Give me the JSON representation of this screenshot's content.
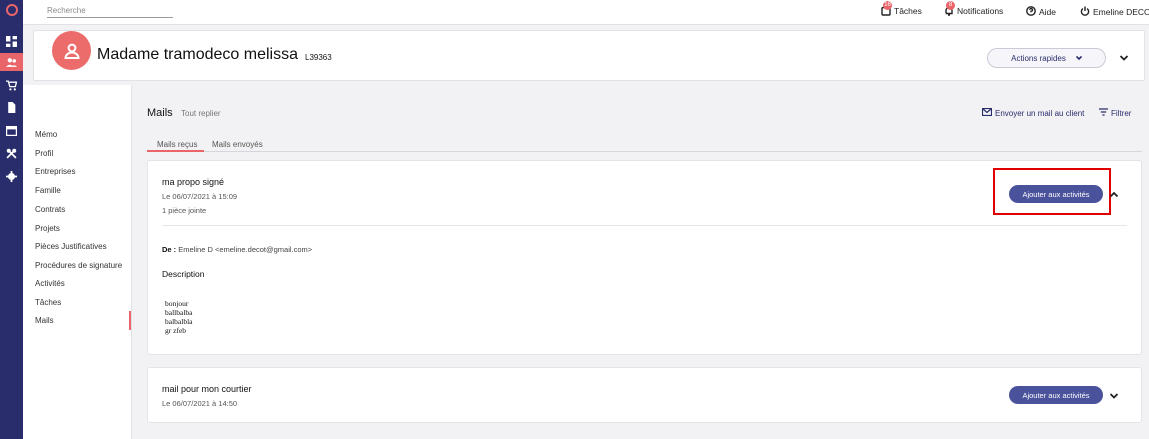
{
  "app": {
    "logo_text": "lya",
    "nav_icons": [
      "dashboard-icon",
      "clients-icon",
      "cart-icon",
      "document-icon",
      "calendar-icon",
      "tools-icon",
      "settings-icon"
    ]
  },
  "topbar": {
    "search_placeholder": "Recherche",
    "tasks_label": "Tâches",
    "tasks_count": "16",
    "notifications_label": "Notifications",
    "notifications_count": "8",
    "help_label": "Aide",
    "user_name": "Emeline DECOT"
  },
  "client": {
    "name": "Madame tramodeco melissa",
    "id": "L39363",
    "quick_actions_label": "Actions rapides"
  },
  "sidebar": {
    "items": [
      {
        "label": "Mémo"
      },
      {
        "label": "Profil"
      },
      {
        "label": "Entreprises"
      },
      {
        "label": "Famille"
      },
      {
        "label": "Contrats"
      },
      {
        "label": "Projets"
      },
      {
        "label": "Pièces Justificatives"
      },
      {
        "label": "Procédures de signature"
      },
      {
        "label": "Activités"
      },
      {
        "label": "Tâches"
      },
      {
        "label": "Mails"
      }
    ],
    "active": "Mails"
  },
  "mails": {
    "title": "Mails",
    "collapse_all": "Tout replier",
    "send_mail_label": "Envoyer un mail au client",
    "filter_label": "Filtrer",
    "tabs": [
      {
        "label": "Mails reçus"
      },
      {
        "label": "Mails envoyés"
      }
    ],
    "active_tab": "Mails reçus",
    "items": [
      {
        "subject": "ma propo signé",
        "date": "Le 06/07/2021 à 15:09",
        "attachments": "1 pièce jointe",
        "add_button": "Ajouter aux activités",
        "from_label": "De :",
        "from_value": "Emeline D <emeline.decot@gmail.com>",
        "description_label": "Description",
        "body_lines": [
          "bonjour",
          "ballbalba",
          "balbalbla",
          "gr zfeb"
        ],
        "expanded": true
      },
      {
        "subject": "mail pour mon courtier",
        "date": "Le 06/07/2021 à 14:50",
        "add_button": "Ajouter aux activités",
        "expanded": false
      }
    ]
  },
  "colors": {
    "nav_bg": "#2a2d6b",
    "accent": "#e9656a",
    "button_bg": "#4a529b",
    "highlight": "#e00000"
  }
}
